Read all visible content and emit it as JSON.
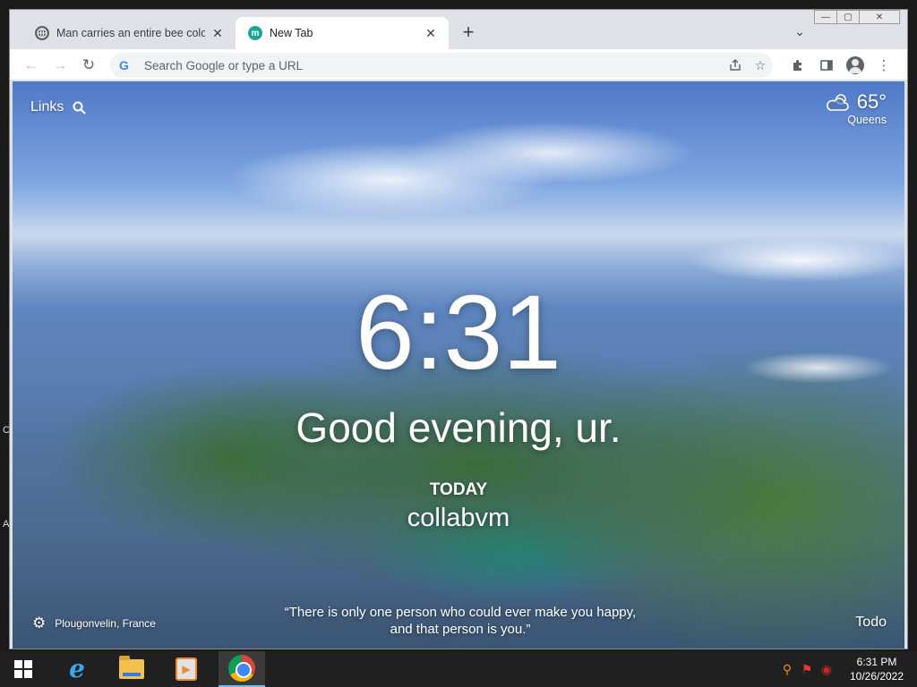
{
  "browser": {
    "tabs": [
      {
        "title": "Man carries an entire bee colony",
        "favicon": "globe-icon",
        "active": false
      },
      {
        "title": "New Tab",
        "favicon_letter": "m",
        "active": true
      }
    ],
    "new_tab_label": "+",
    "omnibox_placeholder": "Search Google or type a URL",
    "window_controls": {
      "minimize": "—",
      "maximize": "▢",
      "close": "✕"
    }
  },
  "newtab": {
    "links_label": "Links",
    "weather": {
      "temp": "65°",
      "location": "Queens",
      "icon": "cloud-icon"
    },
    "time": "6:31",
    "greeting": "Good evening, ur.",
    "focus_label": "TODAY",
    "focus_text": "collabvm",
    "photo_location": "Plougonvelin, France",
    "quote": "“There is only one person who could ever make you happy, and that person is you.”",
    "todo_label": "Todo"
  },
  "taskbar": {
    "apps": [
      "start-button",
      "internet-explorer",
      "file-explorer",
      "media-player",
      "chrome"
    ],
    "tray_time": "6:31 PM",
    "tray_date": "10/26/2022"
  },
  "desktop": {
    "edge_fragments": [
      "C",
      "A"
    ]
  }
}
